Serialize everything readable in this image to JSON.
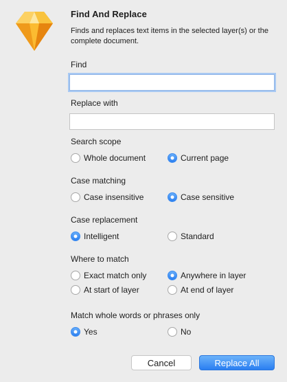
{
  "dialog": {
    "title": "Find And Replace",
    "description": "Finds and replaces text items in the selected layer(s) or the complete document.",
    "icon": "sketch-diamond-icon"
  },
  "find": {
    "label": "Find",
    "value": "",
    "placeholder": ""
  },
  "replace": {
    "label": "Replace with",
    "value": "",
    "placeholder": ""
  },
  "search_scope": {
    "label": "Search scope",
    "options": [
      "Whole document",
      "Current page"
    ],
    "selected": "Current page"
  },
  "case_matching": {
    "label": "Case matching",
    "options": [
      "Case insensitive",
      "Case sensitive"
    ],
    "selected": "Case sensitive"
  },
  "case_replacement": {
    "label": "Case replacement",
    "options": [
      "Intelligent",
      "Standard"
    ],
    "selected": "Intelligent"
  },
  "where_to_match": {
    "label": "Where to match",
    "options": [
      "Exact match only",
      "Anywhere in layer",
      "At start of layer",
      "At end of layer"
    ],
    "selected": "Anywhere in layer"
  },
  "whole_words": {
    "label": "Match whole words or phrases only",
    "options": [
      "Yes",
      "No"
    ],
    "selected": "Yes"
  },
  "buttons": {
    "cancel": "Cancel",
    "replace_all": "Replace All"
  },
  "colors": {
    "accent": "#2c7ff0",
    "background": "#ececec",
    "icon_gold": "#f7b523",
    "icon_orange": "#ea8b16"
  }
}
